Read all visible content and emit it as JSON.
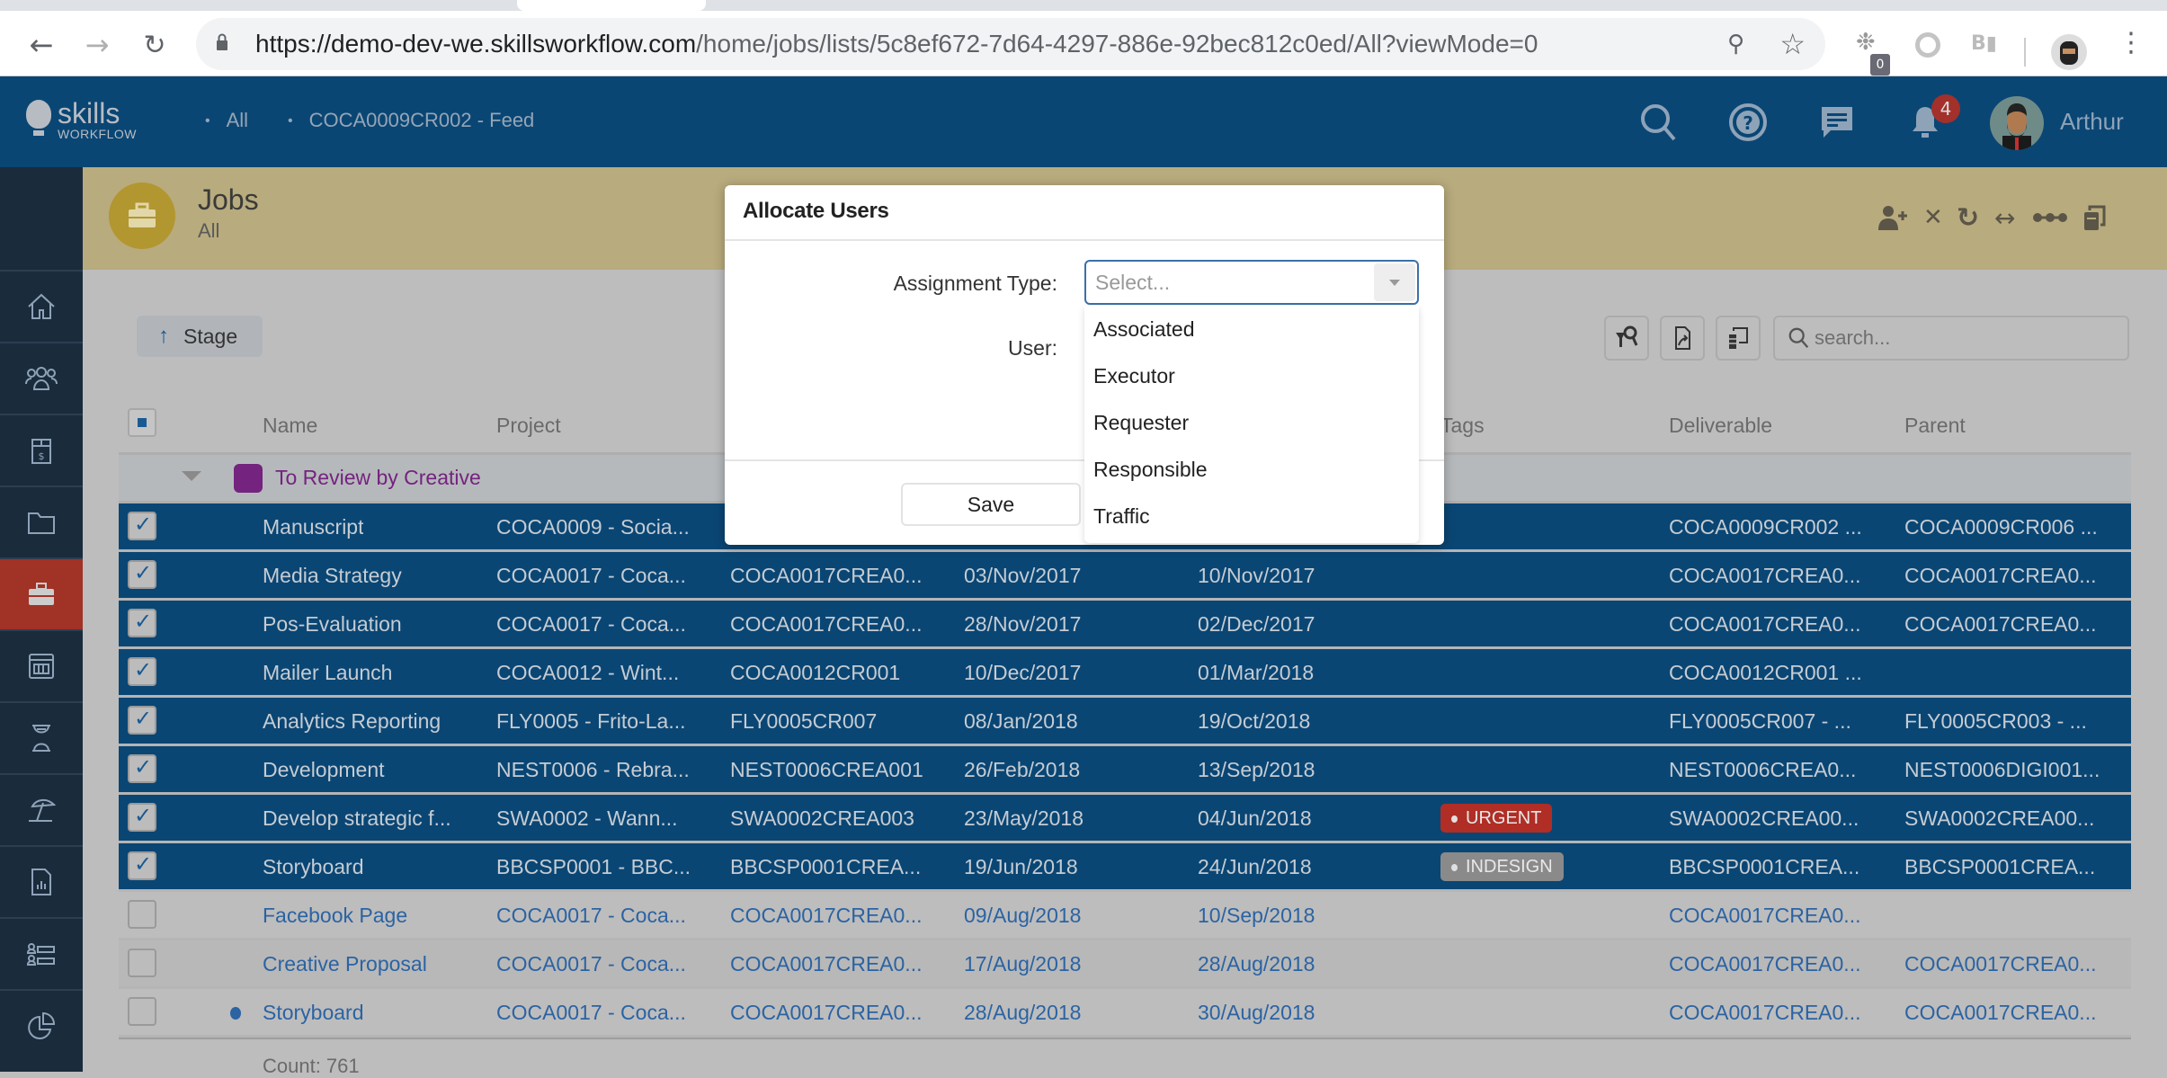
{
  "browser": {
    "url_host": "https://demo-dev-we.skillsworkflow.com",
    "url_path": "/home/jobs/lists/5c8ef672-7d64-4297-886e-92bec812c0ed/All?viewMode=0",
    "extension_badge": "0",
    "icons": [
      "back-icon",
      "forward-icon",
      "reload-icon",
      "lock-icon",
      "key-icon",
      "star-icon",
      "extension-icon",
      "circle-extension-icon",
      "video-extension-icon",
      "profile-avatar",
      "kebab-menu-icon"
    ]
  },
  "app": {
    "logo_word1": "skills",
    "logo_word2": "WORKFLOW",
    "breadcrumbs": [
      "All",
      "COCA0009CR002 - Feed"
    ],
    "notification_count": "4",
    "username": "Arthur",
    "colors": {
      "header": "#0a4674",
      "sidebar": "#1a2b3c",
      "active_nav": "#a03226",
      "band": "#b8ab7d",
      "selected_row": "#0a4674",
      "group": "#74237f"
    }
  },
  "sidebar": {
    "items": [
      {
        "name": "home",
        "active": false
      },
      {
        "name": "people",
        "active": false
      },
      {
        "name": "budget",
        "active": false
      },
      {
        "name": "folder",
        "active": false
      },
      {
        "name": "jobs",
        "active": true
      },
      {
        "name": "calendar",
        "active": false
      },
      {
        "name": "timesheet",
        "active": false
      },
      {
        "name": "absence",
        "active": false
      },
      {
        "name": "reports",
        "active": false
      },
      {
        "name": "resources",
        "active": false
      },
      {
        "name": "analytics",
        "active": false
      }
    ]
  },
  "page": {
    "title": "Jobs",
    "subtitle": "All",
    "header_actions": [
      "add-user",
      "close",
      "refresh",
      "expand",
      "more",
      "copy"
    ]
  },
  "toolbar": {
    "stage_label": "Stage",
    "search_placeholder": "search..."
  },
  "table": {
    "columns": [
      "Name",
      "Project",
      "Tags",
      "Deliverable",
      "Parent"
    ],
    "group": {
      "name": "To Review by Creative"
    },
    "rows": [
      {
        "selected": true,
        "name": "Manuscript",
        "project": "COCA0009 - Socia...",
        "job": "",
        "start": "",
        "end": "",
        "tag": "",
        "deliverable": "COCA0009CR002 ...",
        "parent": "COCA0009CR006 ..."
      },
      {
        "selected": true,
        "name": "Media Strategy",
        "project": "COCA0017 - Coca...",
        "job": "COCA0017CREA0...",
        "start": "03/Nov/2017",
        "end": "10/Nov/2017",
        "tag": "",
        "deliverable": "COCA0017CREA0...",
        "parent": "COCA0017CREA0..."
      },
      {
        "selected": true,
        "name": "Pos-Evaluation",
        "project": "COCA0017 - Coca...",
        "job": "COCA0017CREA0...",
        "start": "28/Nov/2017",
        "end": "02/Dec/2017",
        "tag": "",
        "deliverable": "COCA0017CREA0...",
        "parent": "COCA0017CREA0..."
      },
      {
        "selected": true,
        "name": "Mailer Launch",
        "project": "COCA0012 - Wint...",
        "job": "COCA0012CR001",
        "start": "10/Dec/2017",
        "end": "01/Mar/2018",
        "tag": "",
        "deliverable": "COCA0012CR001 ...",
        "parent": ""
      },
      {
        "selected": true,
        "name": "Analytics Reporting",
        "project": "FLY0005 - Frito-La...",
        "job": "FLY0005CR007",
        "start": "08/Jan/2018",
        "end": "19/Oct/2018",
        "tag": "",
        "deliverable": "FLY0005CR007 - ...",
        "parent": "FLY0005CR003 - ..."
      },
      {
        "selected": true,
        "name": "Development",
        "project": "NEST0006 - Rebra...",
        "job": "NEST0006CREA001",
        "start": "26/Feb/2018",
        "end": "13/Sep/2018",
        "tag": "",
        "deliverable": "NEST0006CREA0...",
        "parent": "NEST0006DIGI001..."
      },
      {
        "selected": true,
        "name": "Develop strategic f...",
        "project": "SWA0002 - Wann...",
        "job": "SWA0002CREA003",
        "start": "23/May/2018",
        "end": "04/Jun/2018",
        "tag": "URGENT",
        "deliverable": "SWA0002CREA00...",
        "parent": "SWA0002CREA00..."
      },
      {
        "selected": true,
        "name": "Storyboard",
        "project": "BBCSP0001 - BBC...",
        "job": "BBCSP0001CREA...",
        "start": "19/Jun/2018",
        "end": "24/Jun/2018",
        "tag": "INDESIGN",
        "deliverable": "BBCSP0001CREA...",
        "parent": "BBCSP0001CREA..."
      },
      {
        "selected": false,
        "name": "Facebook Page",
        "project": "COCA0017 - Coca...",
        "job": "COCA0017CREA0...",
        "start": "09/Aug/2018",
        "end": "10/Sep/2018",
        "tag": "",
        "deliverable": "COCA0017CREA0...",
        "parent": ""
      },
      {
        "selected": false,
        "name": "Creative Proposal",
        "project": "COCA0017 - Coca...",
        "job": "COCA0017CREA0...",
        "start": "17/Aug/2018",
        "end": "28/Aug/2018",
        "tag": "",
        "deliverable": "COCA0017CREA0...",
        "parent": "COCA0017CREA0..."
      },
      {
        "selected": false,
        "name": "Storyboard",
        "project": "COCA0017 - Coca...",
        "job": "COCA0017CREA0...",
        "start": "28/Aug/2018",
        "end": "30/Aug/2018",
        "tag": "",
        "deliverable": "COCA0017CREA0...",
        "parent": "COCA0017CREA0...",
        "unread": true
      }
    ],
    "count_label": "Count: 761"
  },
  "modal": {
    "title": "Allocate Users",
    "assignment_type_label": "Assignment Type:",
    "assignment_type_placeholder": "Select...",
    "assignment_type_options": [
      "Associated",
      "Executor",
      "Requester",
      "Responsible",
      "Traffic"
    ],
    "user_label": "User:",
    "save_label": "Save"
  }
}
